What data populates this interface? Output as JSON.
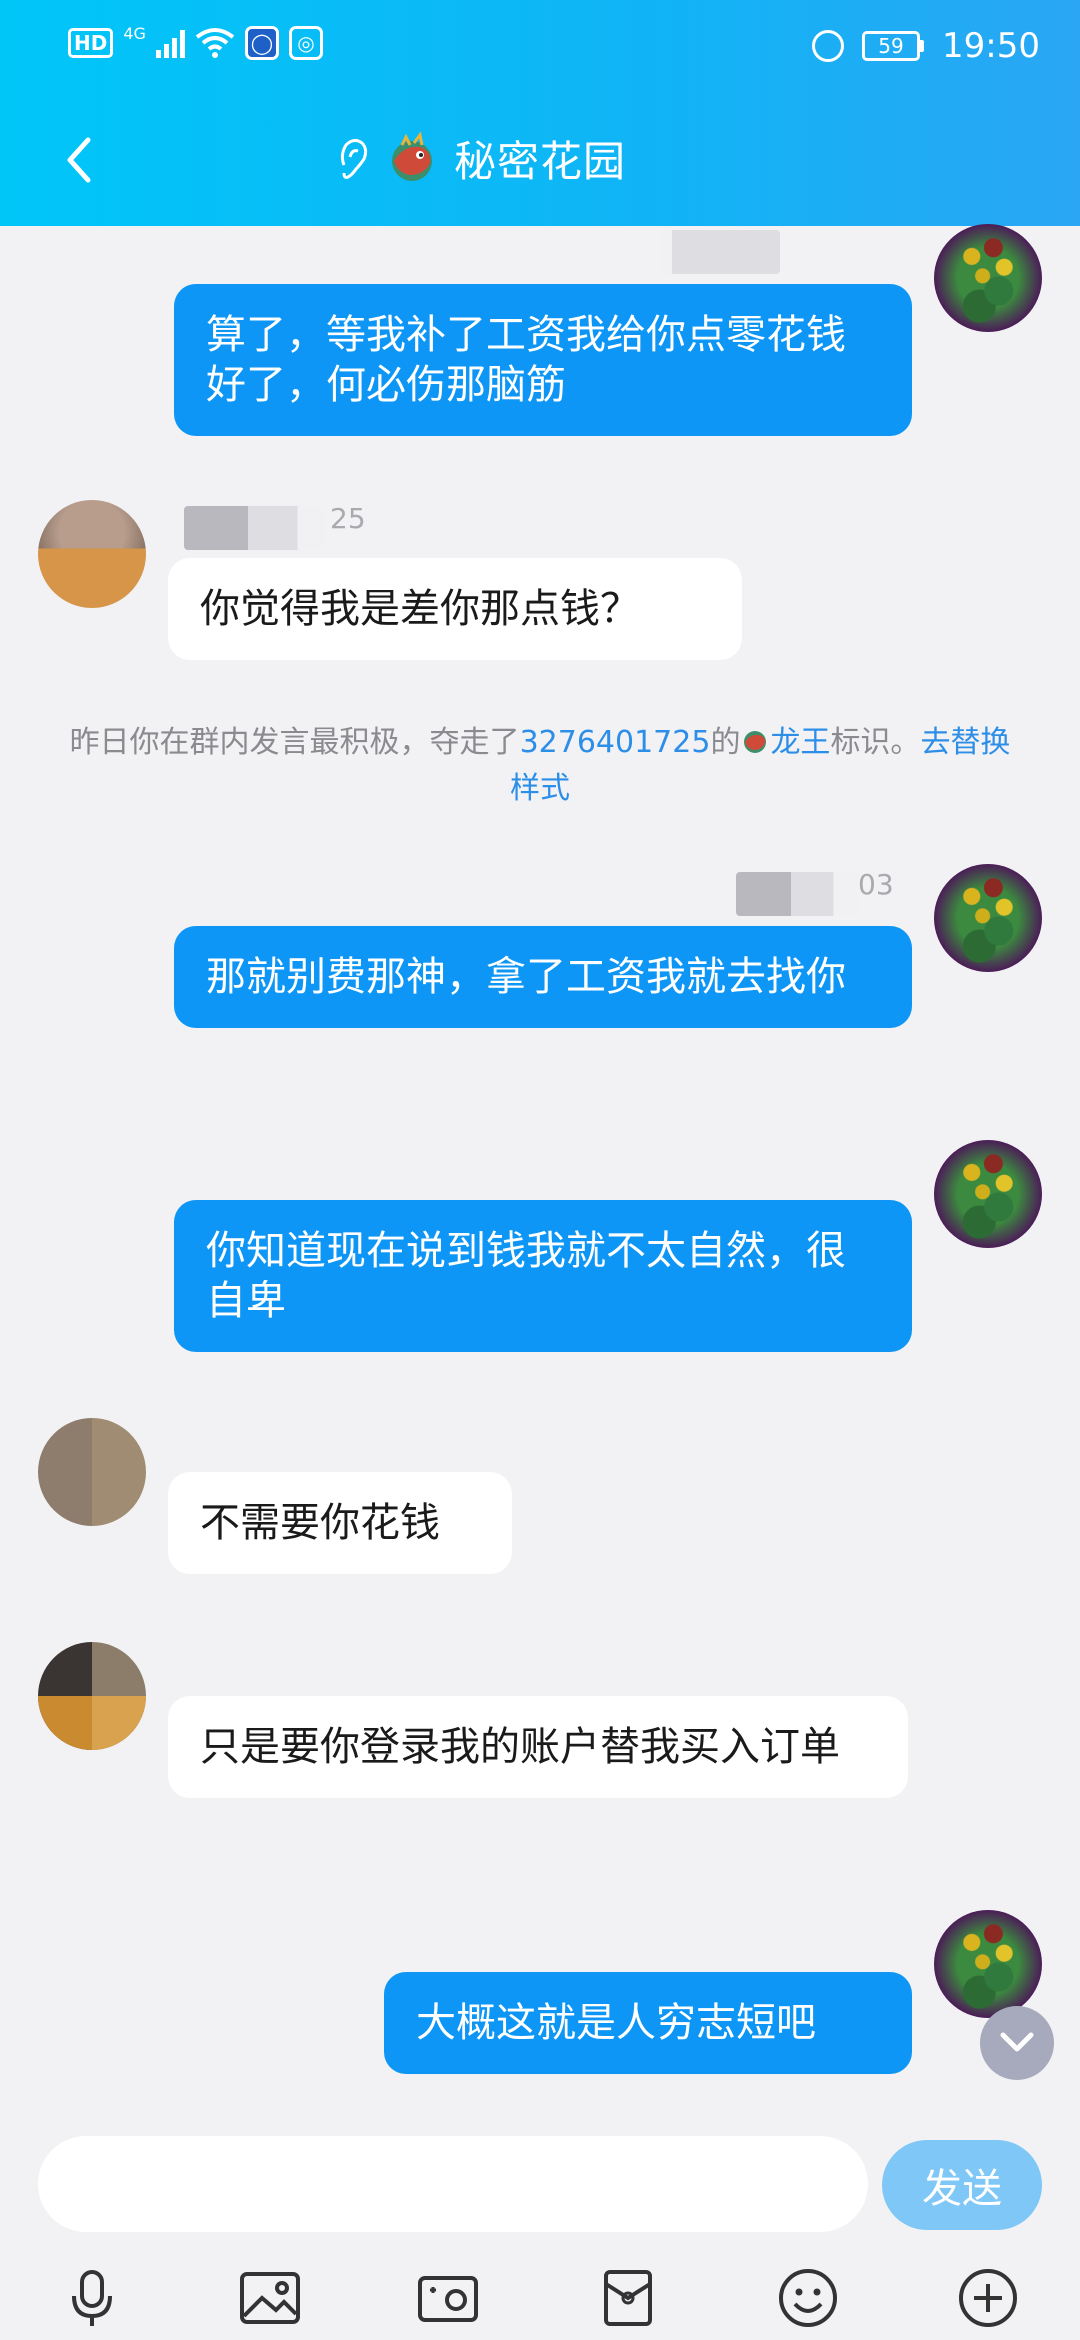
{
  "status_bar": {
    "hd": "HD",
    "network": "4G",
    "battery": "59",
    "time": "19:50"
  },
  "header": {
    "title": "秘密花园",
    "icons": [
      "back-arrow-icon",
      "ear-icon",
      "dragon-emblem-icon"
    ]
  },
  "messages": [
    {
      "side": "self",
      "text": "算了，等我补了工资我给你点零花钱好了，何必伤那脑筋"
    },
    {
      "side": "other",
      "sender_suffix": "25",
      "text": "你觉得我是差你那点钱？"
    },
    {
      "side": "self",
      "sender_suffix": "03",
      "text": "那就别费那神，拿了工资我就去找你"
    },
    {
      "side": "self",
      "text": "你知道现在说到钱我就不太自然，很自卑"
    },
    {
      "side": "other",
      "text": "不需要你花钱"
    },
    {
      "side": "other",
      "text": "只是要你登录我的账户替我买入订单"
    },
    {
      "side": "self",
      "text": "大概这就是人穷志短吧"
    }
  ],
  "system_notice": {
    "part1": "昨日你在群内发言最积极，夺走了",
    "qq_id": "3276401725",
    "part2": "的",
    "title_name": "龙王",
    "part3": "标识。",
    "link": "去替换样式"
  },
  "input": {
    "placeholder": "",
    "value": "",
    "send_label": "发送"
  },
  "toolbar": [
    "microphone-icon",
    "image-icon",
    "camera-icon",
    "red-packet-icon",
    "emoji-icon",
    "plus-icon"
  ],
  "colors": {
    "header_start": "#00c6f8",
    "header_end": "#2aa6f4",
    "self_bubble": "#0d96f5",
    "other_bubble": "#ffffff",
    "link": "#2d8ee8",
    "send_button": "#7ec7f7"
  }
}
